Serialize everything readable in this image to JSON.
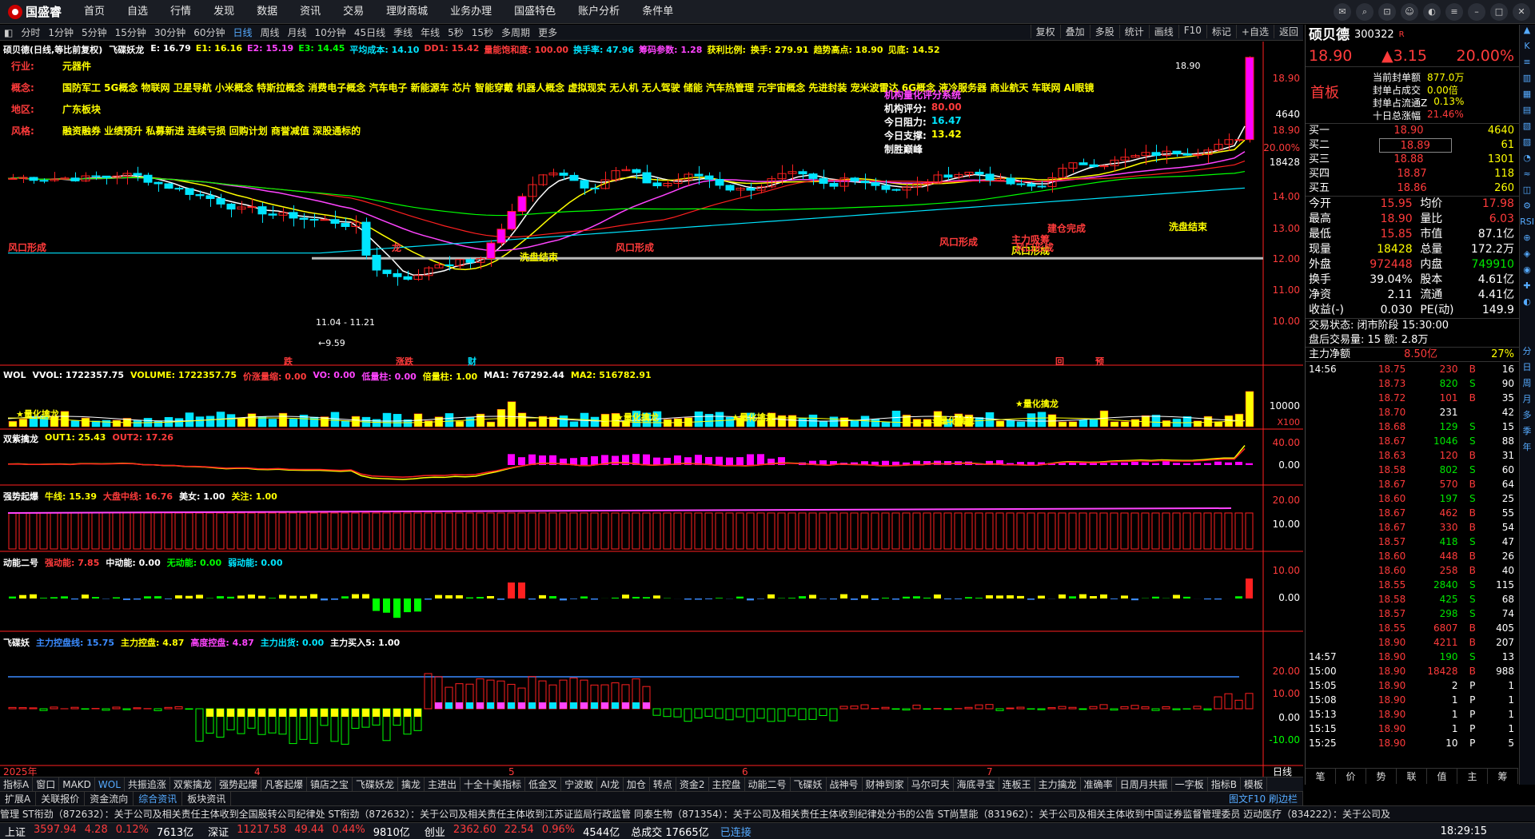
{
  "app": {
    "logo": "国盛睿",
    "menu": [
      "首页",
      "自选",
      "行情",
      "发现",
      "数据",
      "资讯",
      "交易",
      "理财商城",
      "业务办理",
      "国盛特色",
      "账户分析",
      "条件单"
    ]
  },
  "periods": {
    "items": [
      "分时",
      "1分钟",
      "5分钟",
      "15分钟",
      "30分钟",
      "60分钟",
      "日线",
      "周线",
      "月线",
      "10分钟",
      "45日线",
      "季线",
      "年线",
      "5秒",
      "15秒",
      "多周期",
      "更多"
    ],
    "active": "日线",
    "tools": [
      "复权",
      "叠加",
      "多股",
      "统计",
      "画线",
      "F10",
      "标记",
      "+自选",
      "返回"
    ]
  },
  "main": {
    "title": "硕贝德(日线,等比前复权)",
    "indicator_name": "飞碟妖龙",
    "legend": [
      {
        "t": "E: 16.79",
        "c": "#ffffff"
      },
      {
        "t": "E1: 16.16",
        "c": "#ffff00"
      },
      {
        "t": "E2: 15.19",
        "c": "#ff44ff"
      },
      {
        "t": "E3: 14.45",
        "c": "#00ff00"
      },
      {
        "t": "平均成本: 14.10",
        "c": "#00e5ff"
      },
      {
        "t": "DD1: 15.42",
        "c": "#ff3b3b"
      },
      {
        "t": "量能饱和度: 100.00",
        "c": "#ff3b3b"
      },
      {
        "t": "换手率: 47.96",
        "c": "#00e5ff"
      },
      {
        "t": "筹码参数: 1.28",
        "c": "#ff44ff"
      },
      {
        "t": "获利比例:",
        "c": "#ffff00"
      },
      {
        "t": "换手: 279.91",
        "c": "#ffff00"
      },
      {
        "t": "趋势高点: 18.90",
        "c": "#ffff00"
      },
      {
        "t": "见底: 14.52",
        "c": "#ffff00"
      }
    ],
    "info_rows": [
      {
        "k": "行业:",
        "v": "元器件"
      },
      {
        "k": "概念:",
        "v": "国防军工 5G概念 物联网 卫星导航 小米概念 特斯拉概念 消费电子概念 汽车电子 新能源车 芯片 智能穿戴 机器人概念 虚拟现实 无人机 无人驾驶 储能 汽车热管理 元宇宙概念 先进封装 宠米波雷达 6G概念 液冷服务器 商业航天 车联网 AI眼镜"
      },
      {
        "k": "地区:",
        "v": "广东板块"
      },
      {
        "k": "风格:",
        "v": "融资融券 业绩预升 私募新进 连续亏损 回购计划 商誉减值 深股通标的"
      }
    ],
    "score_box": {
      "title": "机构量化评分系统",
      "rows": [
        {
          "k": "机构评分:",
          "v": "80.00",
          "c": "#ff3b3b"
        },
        {
          "k": "今日阻力:",
          "v": "16.47",
          "c": "#00e5ff"
        },
        {
          "k": "今日支撑:",
          "v": "13.42",
          "c": "#ffff00"
        }
      ],
      "footer": "制胜巅峰"
    },
    "annotations": [
      "风口形成",
      "洗盘结束",
      "风口形成",
      "风口形成",
      "风口形成",
      "主力吸筹",
      "建仓完成",
      "洗盘结束",
      "龙",
      "风口形成"
    ],
    "range_label": "11.04 - 11.21",
    "low_label": "9.59",
    "high_label": "18.90",
    "markers": [
      "跌",
      "涨跌",
      "财",
      "回",
      "预"
    ]
  },
  "panels": {
    "wol": {
      "name": "WOL",
      "items": [
        {
          "t": "VVOL: 1722357.75",
          "c": "#ffffff"
        },
        {
          "t": "VOLUME: 1722357.75",
          "c": "#ffff00"
        },
        {
          "t": "价涨量缩: 0.00",
          "c": "#ff3b3b"
        },
        {
          "t": "VO: 0.00",
          "c": "#ff44ff"
        },
        {
          "t": "低量柱: 0.00",
          "c": "#ff44ff"
        },
        {
          "t": "倍量柱: 1.00",
          "c": "#ffff00"
        },
        {
          "t": "MA1: 767292.44",
          "c": "#ffffff"
        },
        {
          "t": "MA2: 516782.91",
          "c": "#ffff00"
        }
      ],
      "tag": "量化擒龙",
      "unit": "X100"
    },
    "szql": {
      "name": "双紫擒龙",
      "items": [
        {
          "t": "OUT1: 25.43",
          "c": "#ffff00"
        },
        {
          "t": "OUT2: 17.26",
          "c": "#ff3b3b"
        }
      ]
    },
    "qsqb": {
      "name": "强势起爆",
      "items": [
        {
          "t": "牛线: 15.39",
          "c": "#ffff00"
        },
        {
          "t": "大盘中线: 16.76",
          "c": "#ff3b3b"
        },
        {
          "t": "美女: 1.00",
          "c": "#ffffff"
        },
        {
          "t": "关注: 1.00",
          "c": "#ffff00"
        }
      ]
    },
    "dn2": {
      "name": "动能二号",
      "items": [
        {
          "t": "强动能: 7.85",
          "c": "#ff3b3b"
        },
        {
          "t": "中动能: 0.00",
          "c": "#ffffff"
        },
        {
          "t": "无动能: 0.00",
          "c": "#00ff00"
        },
        {
          "t": "弱动能: 0.00",
          "c": "#00e5ff"
        }
      ]
    },
    "fdy": {
      "name": "飞碟妖",
      "items": [
        {
          "t": "主力控盘线: 15.75",
          "c": "#3a8bff"
        },
        {
          "t": "主力控盘: 4.87",
          "c": "#ffff00"
        },
        {
          "t": "高度控盘: 4.87",
          "c": "#ff44ff"
        },
        {
          "t": "主力出货: 0.00",
          "c": "#00e5ff"
        },
        {
          "t": "主力买入5: 1.00",
          "c": "#ffffff"
        }
      ]
    }
  },
  "axis": {
    "price_ticks": [
      "18.90",
      "4640",
      "18.90",
      "20.00%",
      "18428",
      "14.00",
      "13.00",
      "12.00",
      "11.00",
      "10.00"
    ],
    "wol_ticks": [
      "10000"
    ],
    "szql_ticks": [
      "40.00",
      "0.00"
    ],
    "qsqb_ticks": [
      "20.00",
      "10.00"
    ],
    "dn2_ticks": [
      "10.00",
      "0.00"
    ],
    "fdy_ticks": [
      "20.00",
      "10.00",
      "0.00",
      "-10.00"
    ],
    "x_labels": [
      "2025年",
      "4",
      "5",
      "6",
      "7"
    ],
    "period_label": "日线"
  },
  "quote": {
    "name": "硕贝德",
    "code": "300322",
    "tag": "R",
    "price": "18.90",
    "change": "▲3.15",
    "pct": "20.00%",
    "section": "首板",
    "seal": [
      {
        "k": "当前封单额",
        "v": "877.0万"
      },
      {
        "k": "封单占成交",
        "v": "0.00倍"
      },
      {
        "k": "封单占流通Z",
        "v": "0.13%"
      },
      {
        "k": "十日总涨幅",
        "v": "21.46%"
      }
    ],
    "book": [
      {
        "k": "买一",
        "p": "18.90",
        "v": "4640"
      },
      {
        "k": "买二",
        "p": "18.89",
        "v": "61"
      },
      {
        "k": "买三",
        "p": "18.88",
        "v": "1301"
      },
      {
        "k": "买四",
        "p": "18.87",
        "v": "118"
      },
      {
        "k": "买五",
        "p": "18.86",
        "v": "260"
      }
    ],
    "stats": [
      {
        "k1": "今开",
        "v1": "15.95",
        "c1": "#ff3b3b",
        "k2": "均价",
        "v2": "17.98",
        "c2": "#ff3b3b"
      },
      {
        "k1": "最高",
        "v1": "18.90",
        "c1": "#ff3b3b",
        "k2": "量比",
        "v2": "6.03",
        "c2": "#ff3b3b"
      },
      {
        "k1": "最低",
        "v1": "15.85",
        "c1": "#ff3b3b",
        "k2": "市值",
        "v2": "87.1亿",
        "c2": "#ffffff"
      },
      {
        "k1": "现量",
        "v1": "18428",
        "c1": "#ffff00",
        "k2": "总量",
        "v2": "172.2万",
        "c2": "#ffffff"
      },
      {
        "k1": "外盘",
        "v1": "972448",
        "c1": "#ff3b3b",
        "k2": "内盘",
        "v2": "749910",
        "c2": "#00e600"
      },
      {
        "k1": "换手",
        "v1": "39.04%",
        "c1": "#ffffff",
        "k2": "股本",
        "v2": "4.61亿",
        "c2": "#ffffff"
      },
      {
        "k1": "净资",
        "v1": "2.11",
        "c1": "#ffffff",
        "k2": "流通",
        "v2": "4.41亿",
        "c2": "#ffffff"
      },
      {
        "k1": "收益(-)",
        "v1": "0.030",
        "c1": "#ffffff",
        "k2": "PE(动)",
        "v2": "149.9",
        "c2": "#ffffff"
      }
    ],
    "trade_state": "交易状态: 闭市阶段 15:30:00",
    "after_hours": "盘后交易量: 15  额: 2.8万",
    "netflow": {
      "label": "主力净额",
      "value": "8.50亿",
      "pct": "27%"
    },
    "ticks": [
      {
        "t": "14:56",
        "p": "18.75",
        "v": "230",
        "d": "B",
        "n": "16"
      },
      {
        "t": "",
        "p": "18.73",
        "v": "820",
        "d": "S",
        "n": "90"
      },
      {
        "t": "",
        "p": "18.72",
        "v": "101",
        "d": "B",
        "n": "35"
      },
      {
        "t": "",
        "p": "18.70",
        "v": "231",
        "d": "",
        "n": "42"
      },
      {
        "t": "",
        "p": "18.68",
        "v": "129",
        "d": "S",
        "n": "15"
      },
      {
        "t": "",
        "p": "18.67",
        "v": "1046",
        "d": "S",
        "n": "88"
      },
      {
        "t": "",
        "p": "18.63",
        "v": "120",
        "d": "B",
        "n": "31"
      },
      {
        "t": "",
        "p": "18.58",
        "v": "802",
        "d": "S",
        "n": "60"
      },
      {
        "t": "",
        "p": "18.67",
        "v": "570",
        "d": "B",
        "n": "64"
      },
      {
        "t": "",
        "p": "18.60",
        "v": "197",
        "d": "S",
        "n": "25"
      },
      {
        "t": "",
        "p": "18.67",
        "v": "462",
        "d": "B",
        "n": "55"
      },
      {
        "t": "",
        "p": "18.67",
        "v": "330",
        "d": "B",
        "n": "54"
      },
      {
        "t": "",
        "p": "18.57",
        "v": "418",
        "d": "S",
        "n": "47"
      },
      {
        "t": "",
        "p": "18.60",
        "v": "448",
        "d": "B",
        "n": "26"
      },
      {
        "t": "",
        "p": "18.60",
        "v": "258",
        "d": "B",
        "n": "40"
      },
      {
        "t": "",
        "p": "18.55",
        "v": "2840",
        "d": "S",
        "n": "115"
      },
      {
        "t": "",
        "p": "18.58",
        "v": "425",
        "d": "S",
        "n": "68"
      },
      {
        "t": "",
        "p": "18.57",
        "v": "298",
        "d": "S",
        "n": "74"
      },
      {
        "t": "",
        "p": "18.55",
        "v": "6807",
        "d": "B",
        "n": "405"
      },
      {
        "t": "",
        "p": "18.90",
        "v": "4211",
        "d": "B",
        "n": "207"
      },
      {
        "t": "14:57",
        "p": "18.90",
        "v": "190",
        "d": "S",
        "n": "13"
      },
      {
        "t": "15:00",
        "p": "18.90",
        "v": "18428",
        "d": "B",
        "n": "988"
      },
      {
        "t": "15:05",
        "p": "18.90",
        "v": "2",
        "d": "P",
        "n": "1"
      },
      {
        "t": "15:08",
        "p": "18.90",
        "v": "1",
        "d": "P",
        "n": "1"
      },
      {
        "t": "15:13",
        "p": "18.90",
        "v": "1",
        "d": "P",
        "n": "1"
      },
      {
        "t": "15:15",
        "p": "18.90",
        "v": "1",
        "d": "P",
        "n": "1"
      },
      {
        "t": "15:25",
        "p": "18.90",
        "v": "10",
        "d": "P",
        "n": "5"
      }
    ],
    "bottom_tabs": [
      "笔",
      "价",
      "势",
      "联",
      "值",
      "主",
      "筹"
    ]
  },
  "rightside_icons": [
    "▲",
    "K",
    "≡",
    "▥",
    "▦",
    "▤",
    "▧",
    "▨",
    "◔",
    "≈",
    "◫",
    "⚙",
    "RSI",
    "⊕",
    "◈",
    "◉",
    "✚",
    "◐"
  ],
  "rightside_dates": [
    "分",
    "日",
    "周",
    "月",
    "多",
    "季",
    "年"
  ],
  "tabs": [
    "指标A",
    "窗口",
    "MAKD",
    "WOL",
    "共振追涨",
    "双紫擒龙",
    "强势起爆",
    "凡客起爆",
    "镇店之宝",
    "飞碟妖龙",
    "擒龙",
    "主进出",
    "十全十美指标",
    "低金叉",
    "宁波敢",
    "AI龙",
    "加仓",
    "转点",
    "资金2",
    "主控盘",
    "动能二号",
    "飞碟妖",
    "战神号",
    "财神到家",
    "马尔可夫",
    "海底寻宝",
    "连板王",
    "主力擒龙",
    "准确率",
    "日周月共振",
    "一字板",
    "指标B",
    "模板"
  ],
  "news_tabs": [
    "扩展A",
    "关联报价",
    "资金流向",
    "综合资讯",
    "板块资讯"
  ],
  "right_tab_label": "图文F10 刷边栏",
  "ticker": "管理    ST衔劲（872632）：关于公司及相关责任主体收到全国股转公司纪律处    ST衔劲（872632）：关于公司及相关责任主体收到江苏证监局行政监管    同泰生物（871354）：关于公司及相关责任主体收到纪律处分书的公告    ST尚慧能（831962）：关于公司及相关主体收到中国证券监督管理委员    迈动医疗（834222）：关于公司及",
  "status": [
    {
      "k": "上证",
      "v": "3597.94",
      "c": "4.28",
      "p": "0.12%",
      "a": "7613亿"
    },
    {
      "k": "深证",
      "v": "11217.58",
      "c": "49.44",
      "p": "0.44%",
      "a": "9810亿"
    },
    {
      "k": "创业",
      "v": "2362.60",
      "c": "22.54",
      "p": "0.96%",
      "a": "4544亿"
    }
  ],
  "status_total": "总成交 17665亿",
  "status_conn": "已连接",
  "clock": "18:29:15"
}
